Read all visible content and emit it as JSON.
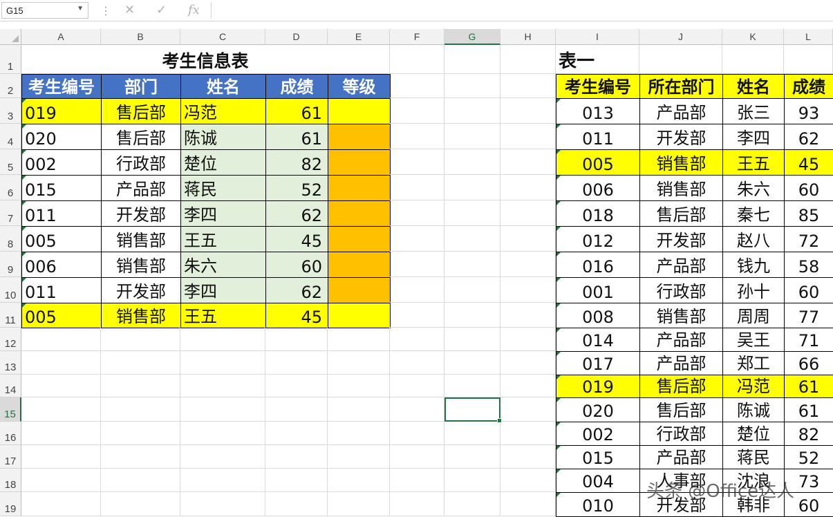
{
  "formula_bar": {
    "name_box": "G15",
    "cancel_icon": "✕",
    "enter_icon": "✓",
    "fx_label": "fx",
    "formula": ""
  },
  "columns": [
    "A",
    "B",
    "C",
    "D",
    "E",
    "F",
    "G",
    "H",
    "I",
    "J",
    "K",
    "L"
  ],
  "rows": [
    "1",
    "2",
    "3",
    "4",
    "5",
    "6",
    "7",
    "8",
    "9",
    "10",
    "11",
    "12",
    "13",
    "14",
    "15",
    "16",
    "17",
    "18",
    "19"
  ],
  "selected_cell": {
    "column": "G",
    "row": "15"
  },
  "left_table": {
    "title": "考生信息表",
    "headers": [
      "考生编号",
      "部门",
      "姓名",
      "成绩",
      "等级"
    ],
    "rows": [
      [
        "019",
        "售后部",
        "冯范",
        "61",
        ""
      ],
      [
        "020",
        "售后部",
        "陈诚",
        "61",
        ""
      ],
      [
        "002",
        "行政部",
        "楚位",
        "82",
        ""
      ],
      [
        "015",
        "产品部",
        "蒋民",
        "52",
        ""
      ],
      [
        "011",
        "开发部",
        "李四",
        "62",
        ""
      ],
      [
        "005",
        "销售部",
        "王五",
        "45",
        ""
      ],
      [
        "006",
        "销售部",
        "朱六",
        "60",
        ""
      ],
      [
        "011",
        "开发部",
        "李四",
        "62",
        ""
      ],
      [
        "005",
        "销售部",
        "王五",
        "45",
        ""
      ]
    ],
    "highlighted_rows": [
      0,
      8
    ]
  },
  "right_table": {
    "title": "表一",
    "headers": [
      "考生编号",
      "所在部门",
      "姓名",
      "成绩"
    ],
    "rows": [
      [
        "013",
        "产品部",
        "张三",
        "93"
      ],
      [
        "011",
        "开发部",
        "李四",
        "62"
      ],
      [
        "005",
        "销售部",
        "王五",
        "45"
      ],
      [
        "006",
        "销售部",
        "朱六",
        "60"
      ],
      [
        "018",
        "售后部",
        "秦七",
        "85"
      ],
      [
        "012",
        "开发部",
        "赵八",
        "72"
      ],
      [
        "016",
        "产品部",
        "钱九",
        "58"
      ],
      [
        "001",
        "行政部",
        "孙十",
        "60"
      ],
      [
        "008",
        "销售部",
        "周周",
        "77"
      ],
      [
        "014",
        "产品部",
        "吴王",
        "71"
      ],
      [
        "017",
        "产品部",
        "郑工",
        "66"
      ],
      [
        "019",
        "售后部",
        "冯范",
        "61"
      ],
      [
        "020",
        "售后部",
        "陈诚",
        "61"
      ],
      [
        "002",
        "行政部",
        "楚位",
        "82"
      ],
      [
        "015",
        "产品部",
        "蒋民",
        "52"
      ],
      [
        "004",
        "人事部",
        "沈浪",
        "73"
      ],
      [
        "010",
        "开发部",
        "韩非",
        "60"
      ]
    ],
    "highlighted_rows": [
      2,
      11
    ]
  },
  "watermark": "头条 @Office达人",
  "colors": {
    "header_blue": "#4472c4",
    "highlight_yellow": "#ffff00",
    "grade_orange": "#ffc000",
    "name_score_green": "#e2efda",
    "selection_green": "#217346"
  }
}
